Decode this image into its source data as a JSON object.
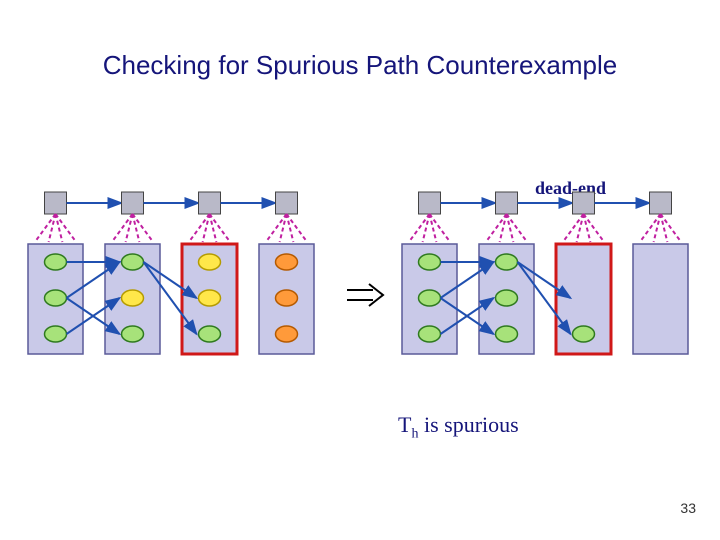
{
  "title": "Checking for Spurious Path Counterexample",
  "labels": {
    "dead_end": "dead-end",
    "caption_html": "T<sub>h</sub> is spurious"
  },
  "pageno": "33",
  "left_diagram": {
    "columns": 4,
    "dead_end_column": 2,
    "nodes_per_column": [
      [
        {
          "kind": "normal"
        },
        {
          "kind": "normal"
        },
        {
          "kind": "normal"
        }
      ],
      [
        {
          "kind": "normal"
        },
        {
          "kind": "yellow"
        },
        {
          "kind": "normal"
        }
      ],
      [
        {
          "kind": "yellow"
        },
        {
          "kind": "yellow"
        },
        {
          "kind": "normal"
        }
      ],
      [
        {
          "kind": "orange"
        },
        {
          "kind": "orange"
        },
        {
          "kind": "orange"
        }
      ]
    ],
    "arrows": [
      {
        "from": [
          0,
          0
        ],
        "to": [
          1,
          0
        ]
      },
      {
        "from": [
          0,
          1
        ],
        "to": [
          1,
          0
        ]
      },
      {
        "from": [
          0,
          1
        ],
        "to": [
          1,
          2
        ]
      },
      {
        "from": [
          0,
          2
        ],
        "to": [
          1,
          1
        ]
      },
      {
        "from": [
          1,
          0
        ],
        "to": [
          2,
          1
        ]
      },
      {
        "from": [
          1,
          0
        ],
        "to": [
          2,
          2
        ]
      }
    ]
  },
  "right_diagram": {
    "columns": 4,
    "dead_end_column": 2,
    "nodes_per_column": [
      [
        {
          "kind": "normal"
        },
        {
          "kind": "normal"
        },
        {
          "kind": "normal"
        }
      ],
      [
        {
          "kind": "normal"
        },
        {
          "kind": "normal"
        },
        {
          "kind": "normal"
        }
      ],
      [
        {
          "kind": "empty"
        },
        {
          "kind": "empty"
        },
        {
          "kind": "normal"
        }
      ],
      [
        {
          "kind": "none"
        },
        {
          "kind": "none"
        },
        {
          "kind": "none"
        }
      ]
    ],
    "arrows": [
      {
        "from": [
          0,
          0
        ],
        "to": [
          1,
          0
        ]
      },
      {
        "from": [
          0,
          1
        ],
        "to": [
          1,
          0
        ]
      },
      {
        "from": [
          0,
          1
        ],
        "to": [
          1,
          2
        ]
      },
      {
        "from": [
          0,
          2
        ],
        "to": [
          1,
          1
        ]
      },
      {
        "from": [
          1,
          0
        ],
        "to": [
          2,
          1
        ]
      },
      {
        "from": [
          1,
          0
        ],
        "to": [
          2,
          2
        ]
      }
    ]
  },
  "chart_data": {
    "type": "diagram",
    "description": "Two side-by-side abstraction diagrams showing spurious counterexample detection in CEGAR-style model checking. Each diagram has four abstract states (top gray boxes) connected to concrete-state columns below; the third column is highlighted as a dead-end. Blue arrows between concrete nodes show reachable transitions. Left diagram: all concrete nodes present; dead-end column has two yellow reachable nodes, fourth column has orange nodes (abstract successor with no concrete reachability). Right diagram: dead-end column concrete interior emptied, fourth column has no concrete nodes — illustrating that the abstract path T_h is spurious.",
    "abstract_states": 4,
    "concrete_per_state": 3,
    "dead_end_index": 2
  }
}
